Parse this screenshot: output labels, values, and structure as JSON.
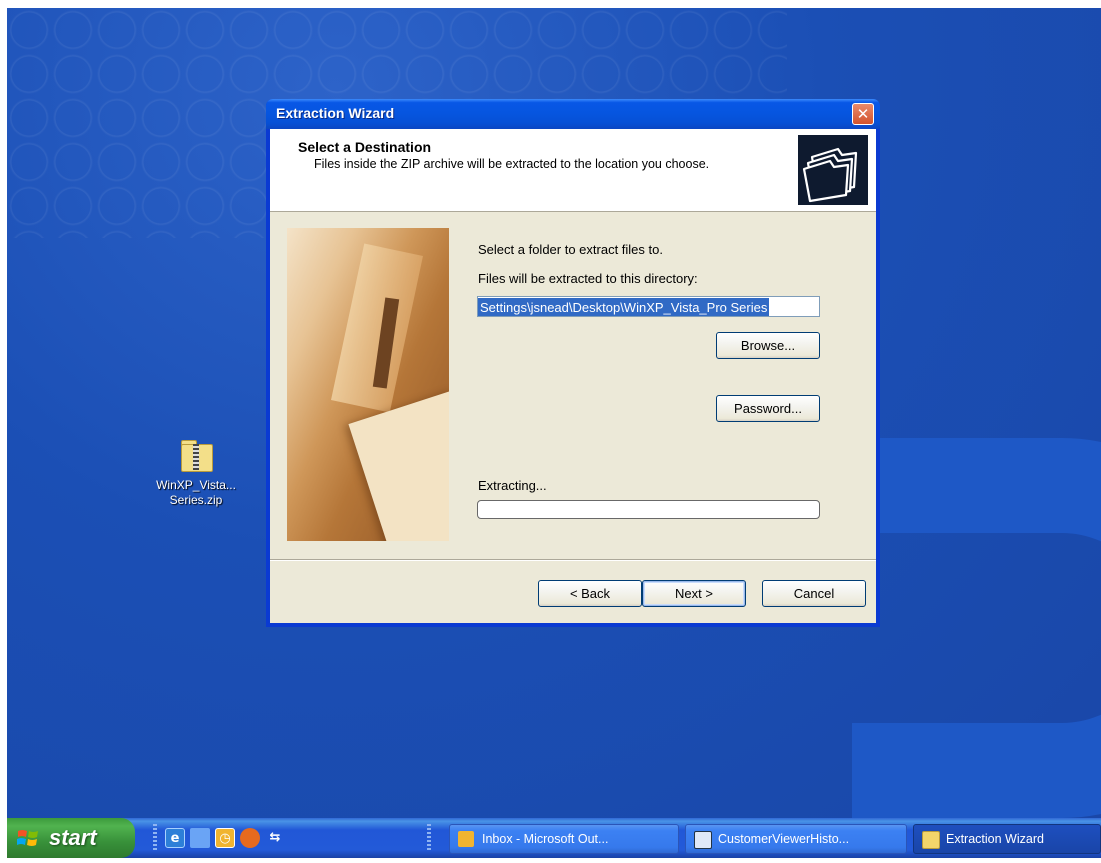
{
  "desktop": {
    "icons": [
      {
        "label_line1": "WinXP_Vista...",
        "label_line2": "Series.zip",
        "icon": "zip-folder-icon"
      }
    ]
  },
  "dialog": {
    "title": "Extraction Wizard",
    "close_glyph": "✕",
    "header": {
      "title": "Select a Destination",
      "subtitle": "Files inside the ZIP archive will be extracted to the location you choose.",
      "icon": "folders-icon"
    },
    "prompt": "Select a folder to extract files to.",
    "directory_label": "Files will be extracted to this directory:",
    "directory_value": "Settings\\jsnead\\Desktop\\WinXP_Vista_Pro Series",
    "browse_label": "Browse...",
    "password_label": "Password...",
    "extracting_label": "Extracting...",
    "progress": 0,
    "back_label": "< Back",
    "next_label": "Next >",
    "cancel_label": "Cancel"
  },
  "taskbar": {
    "start_label": "start",
    "quick_launch": [
      "ie-icon",
      "show-desktop-icon",
      "outlook-icon",
      "firefox-icon",
      "network-icon"
    ],
    "tasks": [
      {
        "label": "Inbox - Microsoft Out...",
        "icon": "outlook-icon",
        "active": false
      },
      {
        "label": "CustomerViewerHisto...",
        "icon": "window-icon",
        "active": false
      },
      {
        "label": "Extraction Wizard",
        "icon": "folder-icon",
        "active": true
      }
    ]
  },
  "colors": {
    "desktop_blue": "#1b4fb5",
    "titlebar_blue": "#0655df",
    "dialog_face": "#ece9d8",
    "selection": "#316ac5",
    "start_green": "#38913a"
  }
}
